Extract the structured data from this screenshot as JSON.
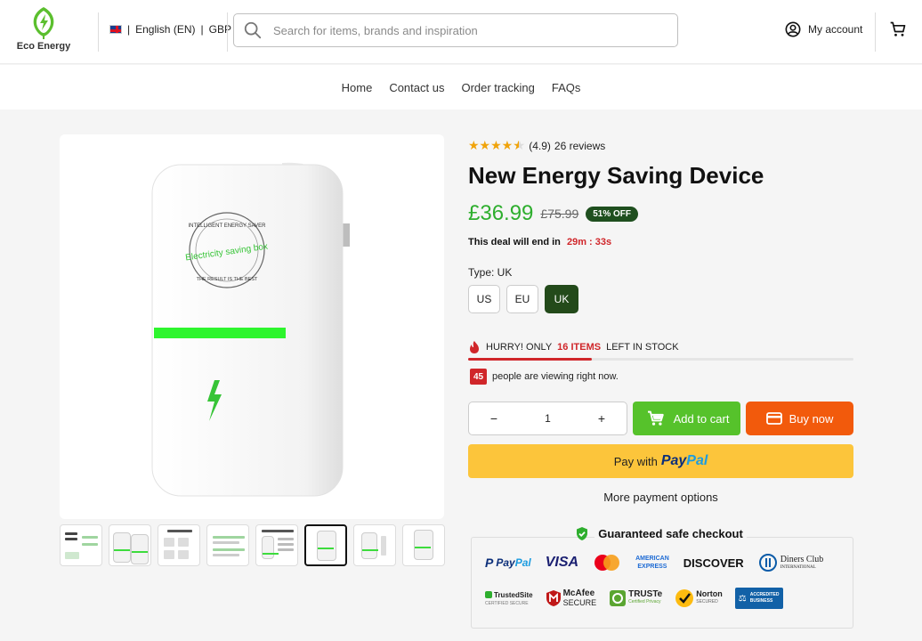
{
  "header": {
    "logo_text": "Eco Energy",
    "language": "English (EN)",
    "currency": "GBP",
    "search_placeholder": "Search for items, brands and inspiration",
    "account_label": "My account"
  },
  "nav": {
    "items": [
      "Home",
      "Contact us",
      "Order tracking",
      "FAQs"
    ]
  },
  "product_image": {
    "circle_text_top": "INTELLIGENT ENERGY SAVER",
    "circle_text_middle": "Electricity saving box",
    "circle_text_bottom": "THE RESULT IS THE BEST"
  },
  "gallery": {
    "thumbnail_count": 8,
    "active_index": 5
  },
  "product": {
    "rating_value": "(4.9)",
    "rating_stars": 4.5,
    "reviews": "26 reviews",
    "title": "New Energy Saving Device",
    "price": "£36.99",
    "compare_price": "£75.99",
    "discount_badge": "51% OFF",
    "deal_text": "This deal will end in",
    "deal_timer": "29m : 33s",
    "type_label": "Type: UK",
    "variants": [
      "US",
      "EU",
      "UK"
    ],
    "selected_variant": "UK",
    "stock_prefix": "HURRY! ONLY",
    "stock_count": "16 ITEMS",
    "stock_suffix": "LEFT IN STOCK",
    "stock_fraction": 0.32,
    "viewers_count": "45",
    "viewers_text": "people are viewing right now.",
    "quantity": "1",
    "add_to_cart_label": "Add to cart",
    "buy_now_label": "Buy now",
    "paypal_prefix": "Pay with",
    "paypal_brand_1": "Pay",
    "paypal_brand_2": "Pal",
    "more_payment_options": "More payment options",
    "safe_checkout_title": "Guaranteed safe checkout"
  },
  "payment_logos": {
    "paypal_1": "Pay",
    "paypal_2": "Pal",
    "visa": "VISA",
    "amex_1": "AMERICAN",
    "amex_2": "EXPRESS",
    "discover": "DISCOVER",
    "diners_1": "Diners Club",
    "diners_2": "INTERNATIONAL"
  },
  "trust_logos": {
    "trustedsite_1": "TrustedSite",
    "trustedsite_2": "CERTIFIED SECURE",
    "mcafee_1": "McAfee",
    "mcafee_2": "SECURE",
    "truste_1": "TRUSTe",
    "truste_2": "Certified Privacy",
    "norton_1": "Norton",
    "norton_2": "SECURED",
    "bbb_1": "ACCREDITED",
    "bbb_2": "BUSINESS"
  },
  "colors": {
    "price_green": "#2eae2e",
    "add_to_cart_green": "#56c22b",
    "buy_now_orange": "#f25a0c",
    "paypal_yellow": "#fcc53b",
    "alert_red": "#d0262a",
    "variant_selected": "#234a1a"
  }
}
